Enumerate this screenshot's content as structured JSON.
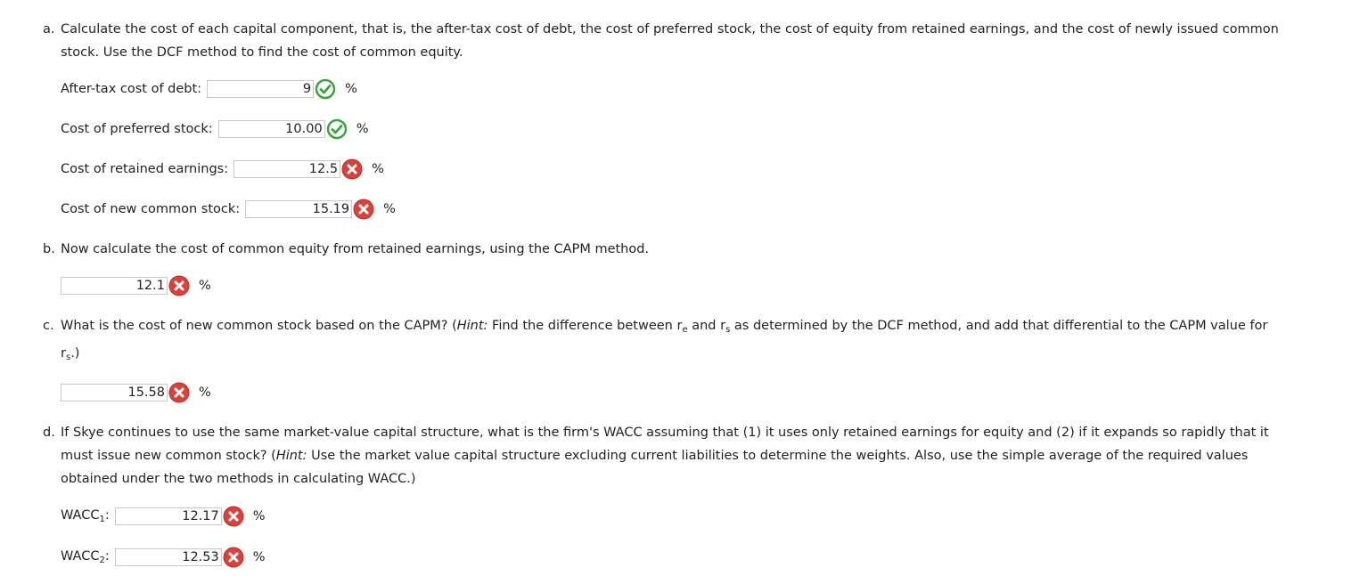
{
  "part_a": {
    "marker": "a.",
    "text": "Calculate the cost of each capital component, that is, the after-tax cost of debt, the cost of preferred stock, the cost of equity from retained earnings, and the cost of newly issued common",
    "text_cont": "stock. Use the DCF method to find the cost of common equity.",
    "rows": [
      {
        "label": "After-tax cost of debt:",
        "value": "9",
        "status": "correct",
        "unit": "%"
      },
      {
        "label": "Cost of preferred stock:",
        "value": "10.00",
        "status": "correct",
        "unit": "%"
      },
      {
        "label": "Cost of retained earnings:",
        "value": "12.5",
        "status": "incorrect",
        "unit": "%"
      },
      {
        "label": "Cost of new common stock:",
        "value": "15.19",
        "status": "incorrect",
        "unit": "%"
      }
    ]
  },
  "part_b": {
    "marker": "b.",
    "text": "Now calculate the cost of common equity from retained earnings, using the CAPM method.",
    "answer": {
      "value": "12.1",
      "status": "incorrect",
      "unit": "%"
    }
  },
  "part_c": {
    "marker": "c.",
    "text_1": "What is the cost of new common stock based on the CAPM? (",
    "hint_label": "Hint:",
    "text_2": " Find the difference between r",
    "sub_e": "e",
    "text_3": " and r",
    "sub_s": "s",
    "text_4": " as determined by the DCF method, and add that differential to the CAPM value for",
    "cont_r": "r",
    "cont_sub": "s",
    "cont_end": ".)",
    "answer": {
      "value": "15.58",
      "status": "incorrect",
      "unit": "%"
    }
  },
  "part_d": {
    "marker": "d.",
    "text_1": "If Skye continues to use the same market-value capital structure, what is the firm's WACC assuming that (1) it uses only retained earnings for equity and (2) if it expands so rapidly that it",
    "text_2a": "must issue new common stock? (",
    "hint_label": "Hint:",
    "text_2b": " Use the market value capital structure excluding current liabilities to determine the weights. Also, use the simple average of the required values",
    "text_3": "obtained under the two methods in calculating WACC.)",
    "rows": [
      {
        "label_base": "WACC",
        "label_sub": "1",
        "label_end": ":",
        "value": "12.17",
        "status": "incorrect",
        "unit": "%"
      },
      {
        "label_base": "WACC",
        "label_sub": "2",
        "label_end": ":",
        "value": "12.53",
        "status": "incorrect",
        "unit": "%"
      }
    ]
  },
  "colors": {
    "correct": "#3aa53a",
    "incorrect": "#d9413a",
    "text": "#222222",
    "field_border": "#c8c8c8"
  },
  "icons": {
    "correct": "check-circle-icon",
    "incorrect": "x-circle-icon"
  }
}
